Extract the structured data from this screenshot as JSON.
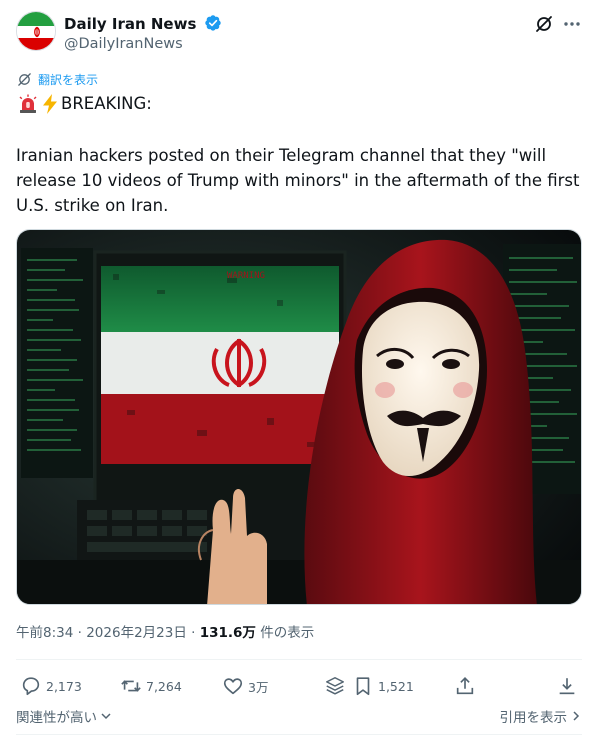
{
  "author": {
    "display_name": "Daily Iran News",
    "handle": "@DailyIranNews",
    "verified": true
  },
  "icons": {
    "avatar": "iran-flag-avatar",
    "verified": "verified-badge-icon",
    "grok": "grok-icon",
    "more": "more-icon",
    "translate": "translate-icon"
  },
  "translate_label": "翻訳を表示",
  "post": {
    "breaking_text": "BREAKING:",
    "breaking_emojis": [
      "siren",
      "lightning"
    ],
    "body": "Iranian hackers posted on their Telegram channel that they \"will release 10 videos of Trump with minors\" in the aftermath of the first U.S. strike on Iran."
  },
  "media": {
    "image_label": "WARNING"
  },
  "meta": {
    "time": "午前8:34",
    "sep1": "·",
    "date": "2026年2月23日",
    "sep2": "·",
    "views_count": "131.6万",
    "views_label": "件の表示"
  },
  "actions": {
    "replies": "2,173",
    "reposts": "7,264",
    "likes": "3万",
    "bookmarks": "1,521"
  },
  "footer": {
    "relevance": "関連性が高い",
    "quotes": "引用を表示"
  },
  "colors": {
    "accent": "#1d9bf0",
    "text_primary": "#0f1419",
    "text_secondary": "#536471",
    "divider": "#eff3f4"
  }
}
